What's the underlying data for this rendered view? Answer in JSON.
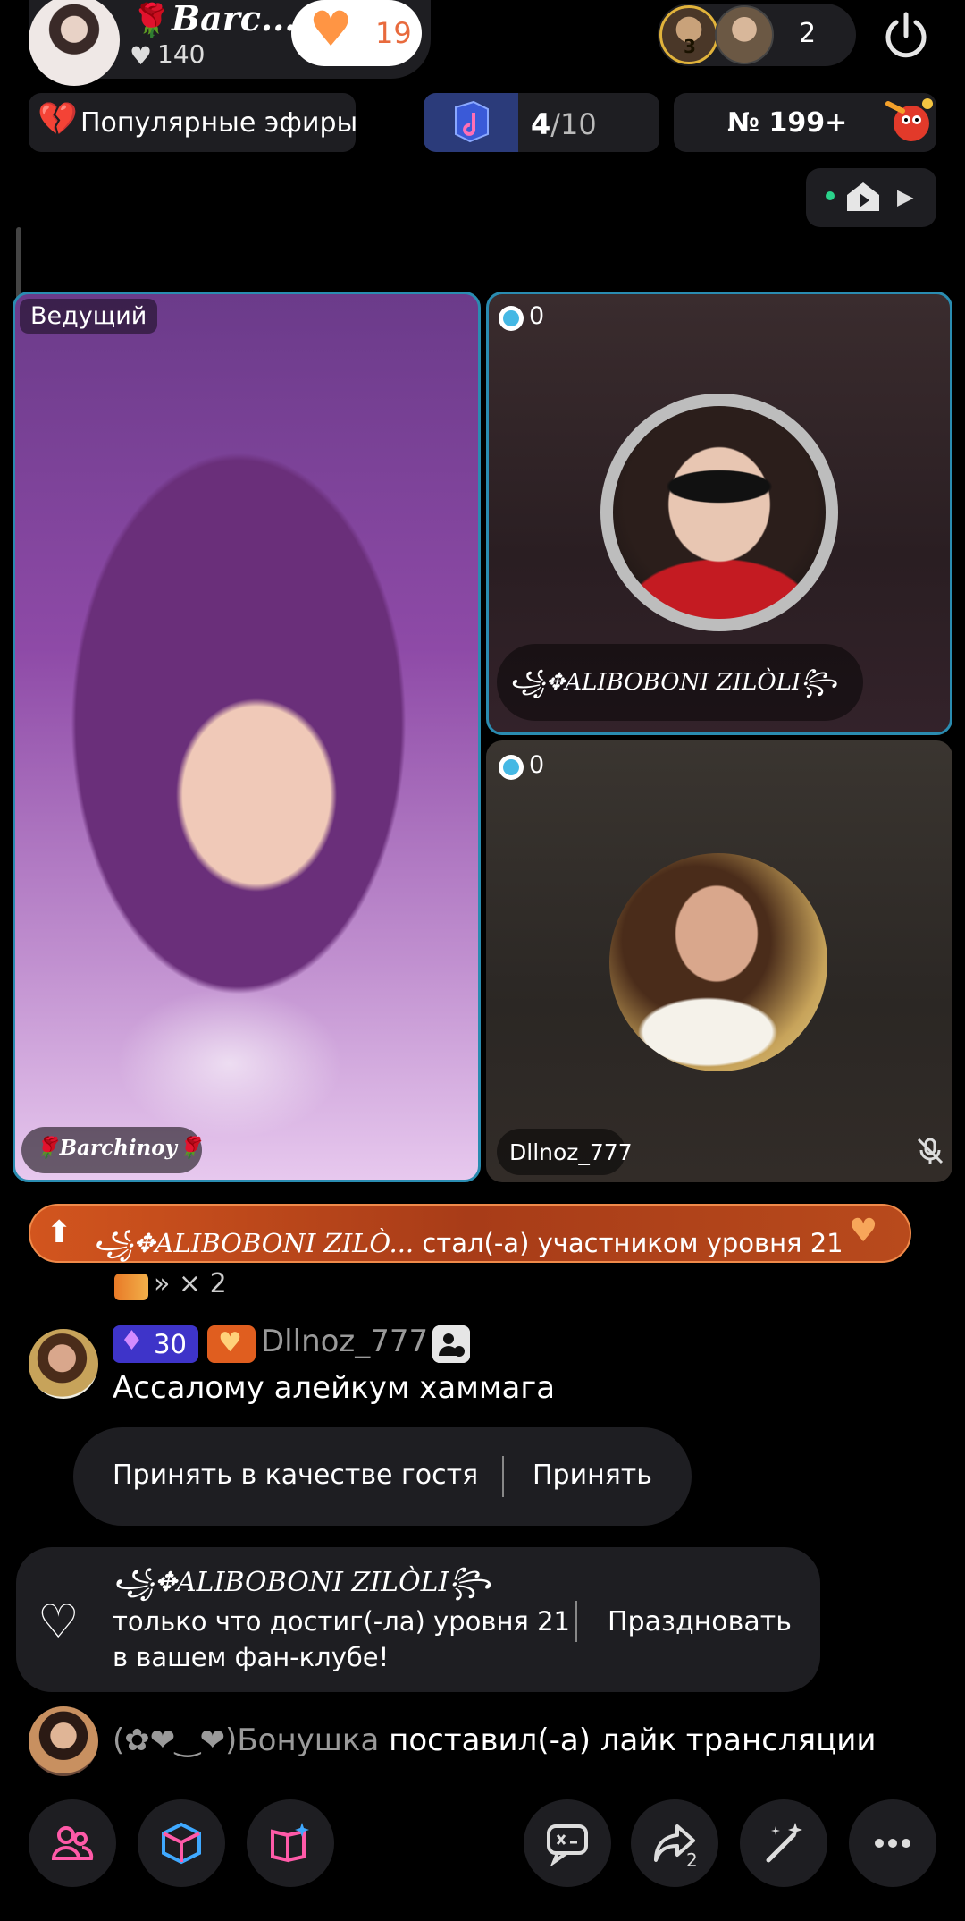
{
  "header": {
    "host_name": "Barc...",
    "host_likes": "140",
    "follow_count": "19",
    "viewer_rank_badge": "3",
    "viewer_count": "2"
  },
  "toolbar_top": {
    "popular_label": "Популярные эфиры",
    "game_progress_current": "4",
    "game_progress_total": "/10",
    "rank_label": "№ 199+"
  },
  "grid": {
    "host_badge": "Ведущий",
    "host_name": "🌹Barchinoy🌹",
    "guest1_seat_count": "0",
    "guest1_name": "꧁✥ALIBOBONI ZILÒLI꧂",
    "guest2_seat_count": "0",
    "guest2_name": "Dllnoz_777"
  },
  "banner": {
    "name": "꧁✥ALIBOBONI ZILÒ...",
    "text": " стал(-а) участником уровня 21"
  },
  "gift_line": "» × 2",
  "chat": {
    "msg1": {
      "diamond_level": "30",
      "user": "Dllnoz_777",
      "text": "Ассалому алейкум хаммага"
    },
    "accept": {
      "guest_label": "Принять в качестве гостя",
      "accept_label": "Принять"
    },
    "fan_card": {
      "name": "꧁✥ALIBOBONI ZILÒLI꧂",
      "line1": "только что достиг(-ла) уровня 21",
      "line2": "в вашем фан-клубе!",
      "button": "Праздновать"
    },
    "msg2": {
      "user": "(✿❤‿❤)Бонушка",
      "text": " поставил(-а) лайк трансляции"
    }
  },
  "bottom_toolbar": {
    "share_count": "2"
  },
  "colors": {
    "accent_tile_border": "#2a8cb1",
    "follow_heart": "#ff9544",
    "banner_orange": "#d2551e",
    "diamond_badge": "#3e34c9",
    "fan_badge": "#e05e1f"
  }
}
